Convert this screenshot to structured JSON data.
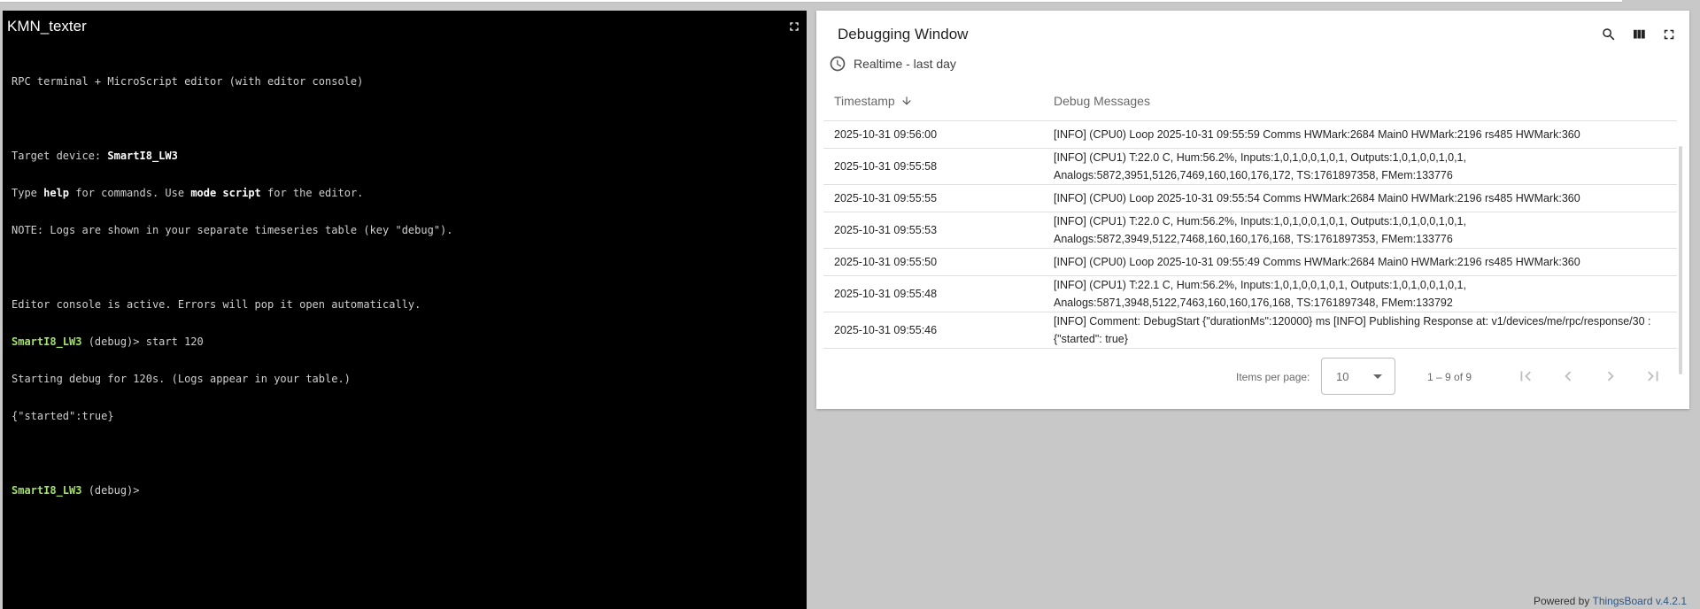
{
  "terminal": {
    "title": "KMN_texter",
    "fullscreen_icon": "fullscreen-icon",
    "intro_line": "RPC terminal + MicroScript editor (with editor console)",
    "target_prefix": "Target device: ",
    "target_device": "SmartI8_LW3",
    "help_pre": "Type ",
    "help_cmd": "help",
    "help_mid": " for commands. Use ",
    "help_mode": "mode script",
    "help_post": " for the editor.",
    "note_line": "NOTE: Logs are shown in your separate timeseries table (key \"debug\").",
    "console_line": "Editor console is active. Errors will pop it open automatically.",
    "prompt_device": "SmartI8_LW3",
    "prompt_mode": " (debug)> ",
    "command": "start 120",
    "response_line": "Starting debug for 120s. (Logs appear in your table.)",
    "response_json": "{\"started\":true}",
    "prompt2_device": "SmartI8_LW3",
    "prompt2_mode": " (debug)>"
  },
  "debug": {
    "title": "Debugging Window",
    "timewindow": "Realtime - last day",
    "icons": [
      "search-icon",
      "columns-icon",
      "fullscreen-icon",
      "clock-icon"
    ],
    "columns": {
      "timestamp": "Timestamp",
      "messages": "Debug Messages"
    },
    "rows": [
      {
        "ts": "2025-10-31 09:56:00",
        "msg": "[INFO] (CPU0) Loop 2025-10-31 09:55:59 Comms HWMark:2684 Main0 HWMark:2196 rs485 HWMark:360"
      },
      {
        "ts": "2025-10-31 09:55:58",
        "msg": "[INFO] (CPU1) T:22.0 C, Hum:56.2%, Inputs:1,0,1,0,0,1,0,1, Outputs:1,0,1,0,0,1,0,1, Analogs:5872,3951,5126,7469,160,160,176,172, TS:1761897358, FMem:133776"
      },
      {
        "ts": "2025-10-31 09:55:55",
        "msg": "[INFO] (CPU0) Loop 2025-10-31 09:55:54 Comms HWMark:2684 Main0 HWMark:2196 rs485 HWMark:360"
      },
      {
        "ts": "2025-10-31 09:55:53",
        "msg": "[INFO] (CPU1) T:22.0 C, Hum:56.2%, Inputs:1,0,1,0,0,1,0,1, Outputs:1,0,1,0,0,1,0,1, Analogs:5872,3949,5122,7468,160,160,176,168, TS:1761897353, FMem:133776"
      },
      {
        "ts": "2025-10-31 09:55:50",
        "msg": "[INFO] (CPU0) Loop 2025-10-31 09:55:49 Comms HWMark:2684 Main0 HWMark:2196 rs485 HWMark:360"
      },
      {
        "ts": "2025-10-31 09:55:48",
        "msg": "[INFO] (CPU1) T:22.1 C, Hum:56.2%, Inputs:1,0,1,0,0,1,0,1, Outputs:1,0,1,0,0,1,0,1, Analogs:5871,3948,5122,7463,160,160,176,168, TS:1761897348, FMem:133792"
      },
      {
        "ts": "2025-10-31 09:55:46",
        "msg": "[INFO] Comment: DebugStart {\"durationMs\":120000} ms [INFO] Publishing Response at: v1/devices/me/rpc/response/30 : {\"started\": true}"
      }
    ],
    "paginator": {
      "items_per_page_label": "Items per page:",
      "page_size": "10",
      "range_label": "1 – 9 of 9",
      "nav_icons": [
        "first-page-icon",
        "prev-page-icon",
        "next-page-icon",
        "last-page-icon"
      ]
    }
  },
  "footer": {
    "powered_by": "Powered by ",
    "brand": "ThingsBoard v.4.2.1"
  }
}
